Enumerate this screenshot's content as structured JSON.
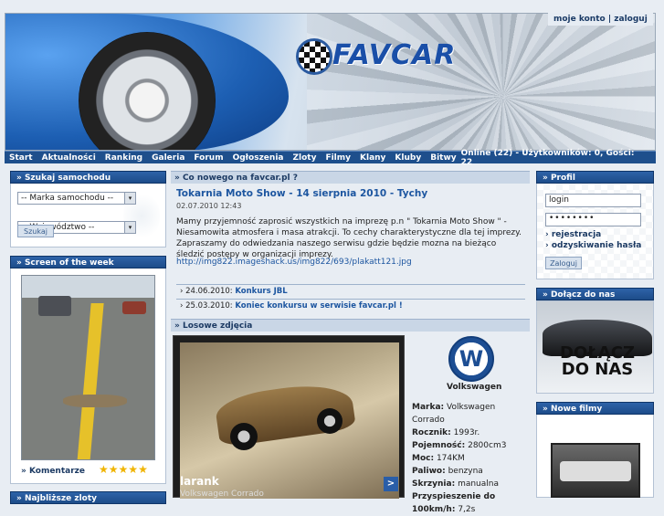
{
  "account": {
    "my_account": "moje konto",
    "separator": "|",
    "login": "zaloguj"
  },
  "logo": {
    "text": "FAVCAR"
  },
  "nav": {
    "items": [
      "Start",
      "Aktualności",
      "Ranking",
      "Galeria",
      "Forum",
      "Ogłoszenia",
      "Zloty",
      "Filmy",
      "Klany",
      "Kluby",
      "Bitwy"
    ],
    "online": "Online (22) - Użytkowników: 0, Gości: 22"
  },
  "search": {
    "title": "Szukaj samochodu",
    "brand": "-- Marka samochodu --",
    "region": "-- Województwo --",
    "button": "Szukaj"
  },
  "screen_of_week": {
    "title": "Screen of the week",
    "comments": "Komentarze",
    "rating": 5
  },
  "whats_new": {
    "title": "Co nowego na favcar.pl ?",
    "article_title": "Tokarnia Moto Show - 14 sierpnia 2010 - Tychy",
    "date": "02.07.2010 12:43",
    "body": "Mamy przyjemność zaprosić wszystkich na imprezę p.n \" Tokarnia Moto Show \" - Niesamowita atmosfera i masa atrakcji. To cechy charakterystyczne dla tej imprezy. Zapraszamy do odwiedzania naszego serwisu gdzie będzie mozna na bieżąco śledzić postępy w organizacji imprezy.",
    "link": "http://img822.imageshack.us/img822/693/plakatt121.jpg",
    "news": [
      {
        "date": "24.06.2010:",
        "title": "Konkurs JBL"
      },
      {
        "date": "25.03.2010:",
        "title": "Koniec konkursu w serwisie favcar.pl !"
      }
    ]
  },
  "random_photos": {
    "title": "Losowe zdjęcia",
    "user": "larank",
    "car": "Volkswagen Corrado",
    "next": ">",
    "brand_label": "Volkswagen",
    "specs": [
      {
        "label": "Marka:",
        "value": "Volkswagen Corrado"
      },
      {
        "label": "Rocznik:",
        "value": "1993r."
      },
      {
        "label": "Pojemność:",
        "value": "2800cm3"
      },
      {
        "label": "Moc:",
        "value": "174KM"
      },
      {
        "label": "Paliwo:",
        "value": "benzyna"
      },
      {
        "label": "Skrzynia:",
        "value": "manualna"
      },
      {
        "label": "Przyspieszenie do 100km/h:",
        "value": "7,2s"
      }
    ]
  },
  "profile": {
    "title": "Profil",
    "login_placeholder": "login",
    "password_value": "••••••••",
    "register": "rejestracja",
    "recover": "odzyskiwanie hasła",
    "button": "Zaloguj"
  },
  "join": {
    "title": "Dołącz do nas",
    "banner_line1": "DOŁĄCZ",
    "banner_line2": "DO NAS"
  },
  "new_films": {
    "title": "Nowe filmy"
  },
  "bottom_left": {
    "title": "Najbliższe zloty"
  },
  "colors": {
    "nav": "#1e4f8c",
    "header_box": "#1d4c89",
    "link": "#1d56a0",
    "accent_star": "#f0b400"
  }
}
